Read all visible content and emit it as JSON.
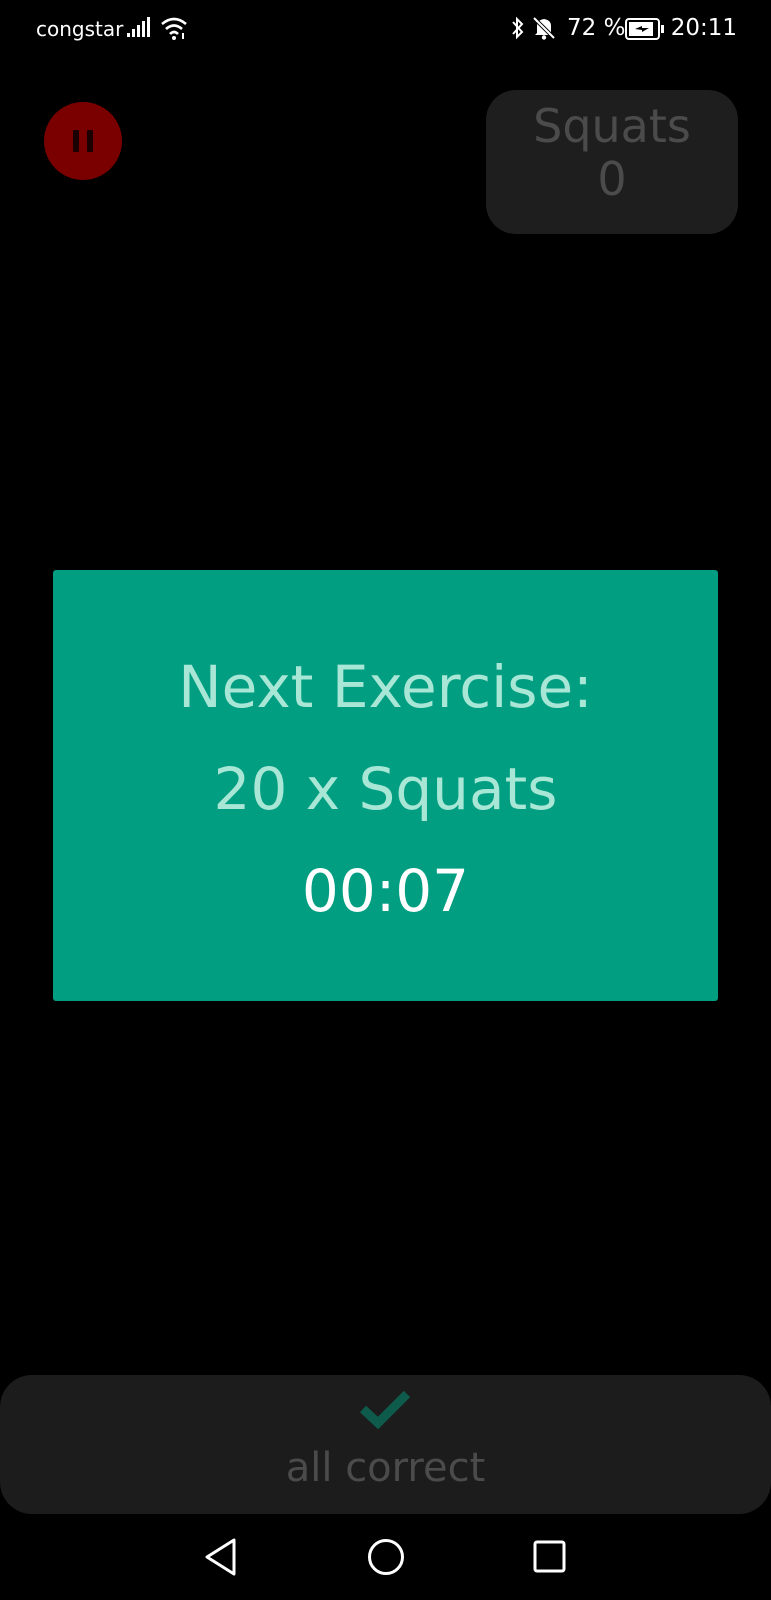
{
  "status_bar": {
    "carrier": "congstar",
    "battery_percent": "72 %",
    "time": "20:11",
    "icons": [
      "signal-icon",
      "wifi-icon",
      "bluetooth-icon",
      "bell-off-icon",
      "battery-charging-icon"
    ]
  },
  "pause_button": {
    "icon": "pause-icon",
    "color": "#7a0000"
  },
  "counter": {
    "exercise": "Squats",
    "count": "0"
  },
  "next_panel": {
    "title": "Next Exercise:",
    "exercise": "20 x Squats",
    "timer": "00:07",
    "color": "#019e82"
  },
  "feedback": {
    "icon": "check-icon",
    "label": "all correct"
  },
  "nav": {
    "icons": [
      "back-icon",
      "home-icon",
      "recents-icon"
    ]
  }
}
